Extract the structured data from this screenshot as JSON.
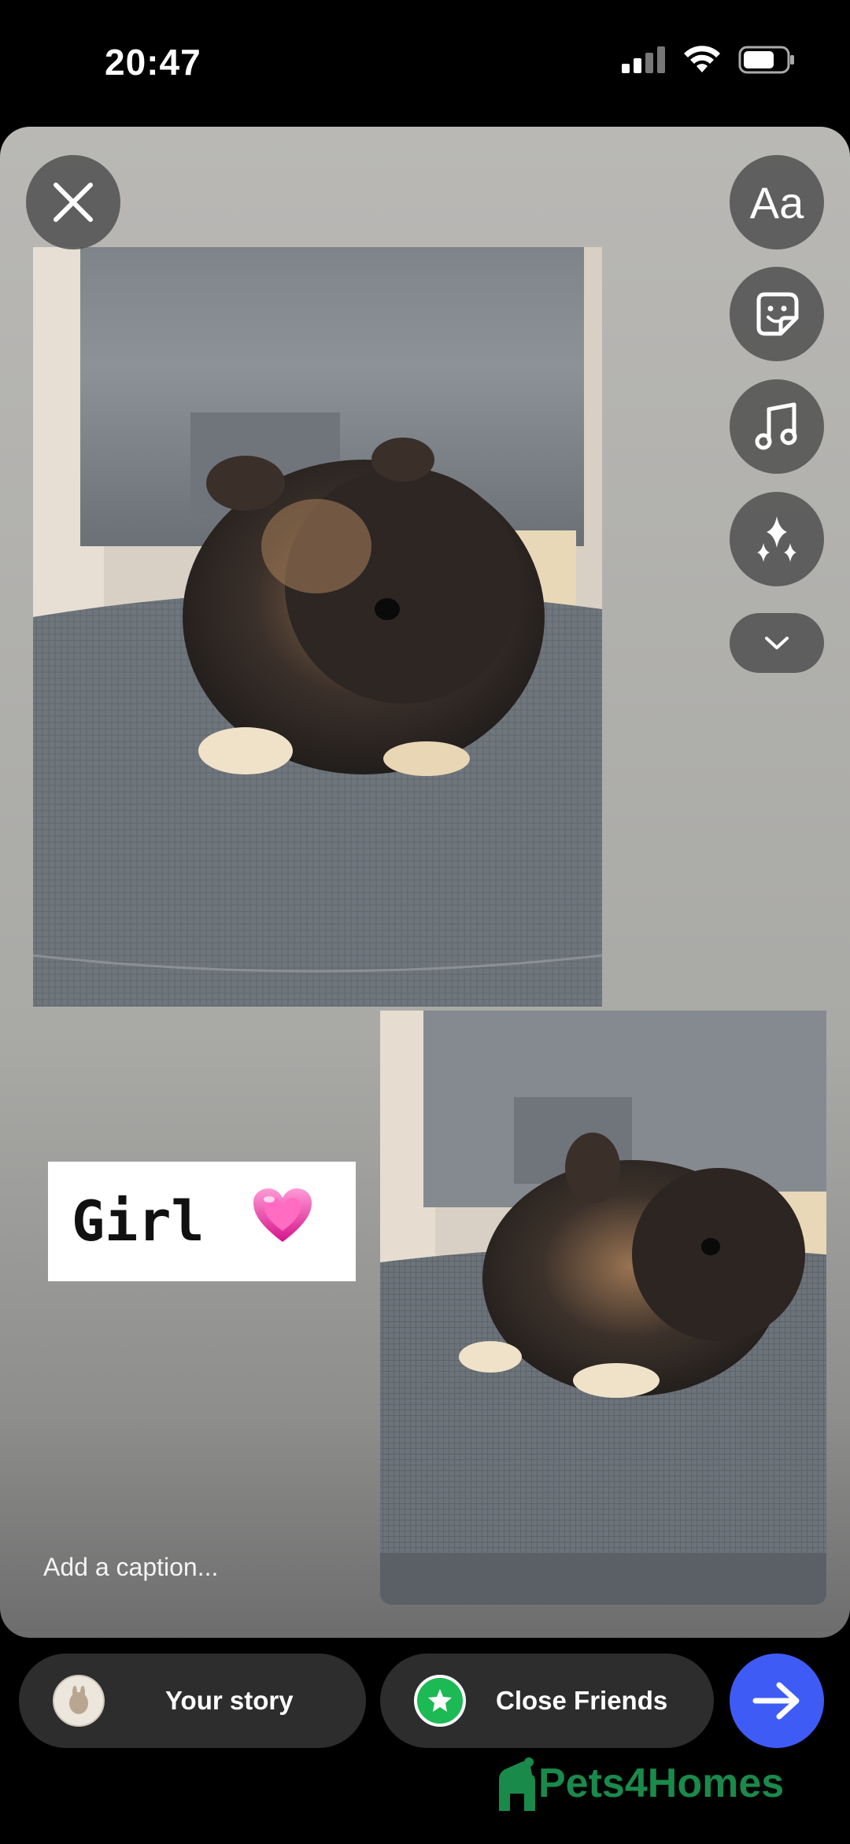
{
  "status_bar": {
    "time": "20:47"
  },
  "story": {
    "sticker_text": "Girl",
    "sticker_emoji": "💗",
    "caption_placeholder": "Add a caption...",
    "tools": [
      "text-tool",
      "sticker-tool",
      "music-tool",
      "effects-tool",
      "more-tools"
    ],
    "text_tool_label": "Aa"
  },
  "share": {
    "your_story_label": "Your story",
    "close_friends_label": "Close Friends"
  },
  "watermark": {
    "brand": "Pets4Homes"
  },
  "colors": {
    "accent_blue": "#3f5bf6",
    "close_friends_green": "#1db954",
    "brand_green": "#1a8a4b"
  }
}
